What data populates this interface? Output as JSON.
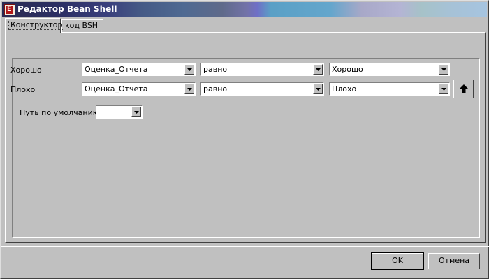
{
  "window": {
    "title": "Редактор Bean Shell",
    "icon": "app-e-icon",
    "icon_glyph": "E"
  },
  "tabs": [
    {
      "label": "Конструктор",
      "active": true
    },
    {
      "label": "код BSH",
      "active": false
    }
  ],
  "rules": [
    {
      "label": "Хорошо",
      "field": "Оценка_Отчета",
      "operator": "равно",
      "value": "Хорошо"
    },
    {
      "label": "Плохо",
      "field": "Оценка_Отчета",
      "operator": "равно",
      "value": "Плохо"
    }
  ],
  "move_up_icon": "arrow-up-icon",
  "default_path": {
    "label": "Путь по умолчанию:",
    "value": ""
  },
  "buttons": {
    "ok": "OK",
    "cancel": "Отмена"
  }
}
